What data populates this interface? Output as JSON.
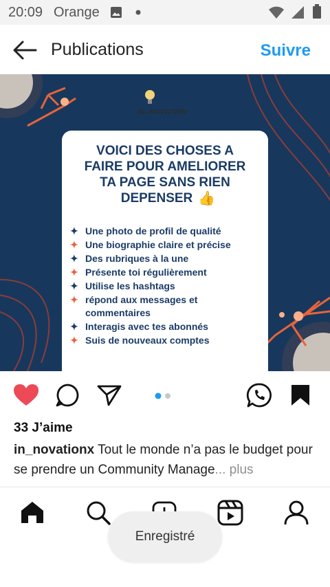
{
  "status_bar": {
    "time": "20:09",
    "carrier": "Orange"
  },
  "header": {
    "title": "Publications",
    "follow_label": "Suivre"
  },
  "post": {
    "brand": "IN–NOVATION",
    "card_title": [
      "VOICI DES CHOSES A",
      "FAIRE POUR AMELIORER",
      "TA PAGE SANS RIEN",
      "DEPENSER"
    ],
    "bullets": [
      "Une photo de profil de qualité",
      "Une biographie claire et précise",
      "Des rubriques à la une",
      "Présente toi régulièrement",
      "Utilise les hashtags",
      "répond aux messages et",
      "commentaires",
      "Interagis avec tes abonnés",
      "Suis de nouveaux comptes"
    ],
    "likes": "33 J’aime",
    "username": "in_novationx",
    "caption": " Tout le monde n’a pas le budget pour se prendre un Community  Manage",
    "more": "... plus"
  },
  "toast": "Enregistré",
  "colors": {
    "accent": "#1d9bf0",
    "like": "#ed4956",
    "post_bg": "#17385c",
    "card_text": "#1b3b66",
    "orange": "#e8643a"
  },
  "icons": [
    "back-arrow-icon",
    "image-icon",
    "wifi-icon",
    "signal-icon",
    "battery-icon",
    "heart-icon",
    "comment-icon",
    "share-icon",
    "whatsapp-icon",
    "bookmark-icon",
    "home-icon",
    "search-icon",
    "add-icon",
    "reels-icon",
    "profile-icon"
  ]
}
